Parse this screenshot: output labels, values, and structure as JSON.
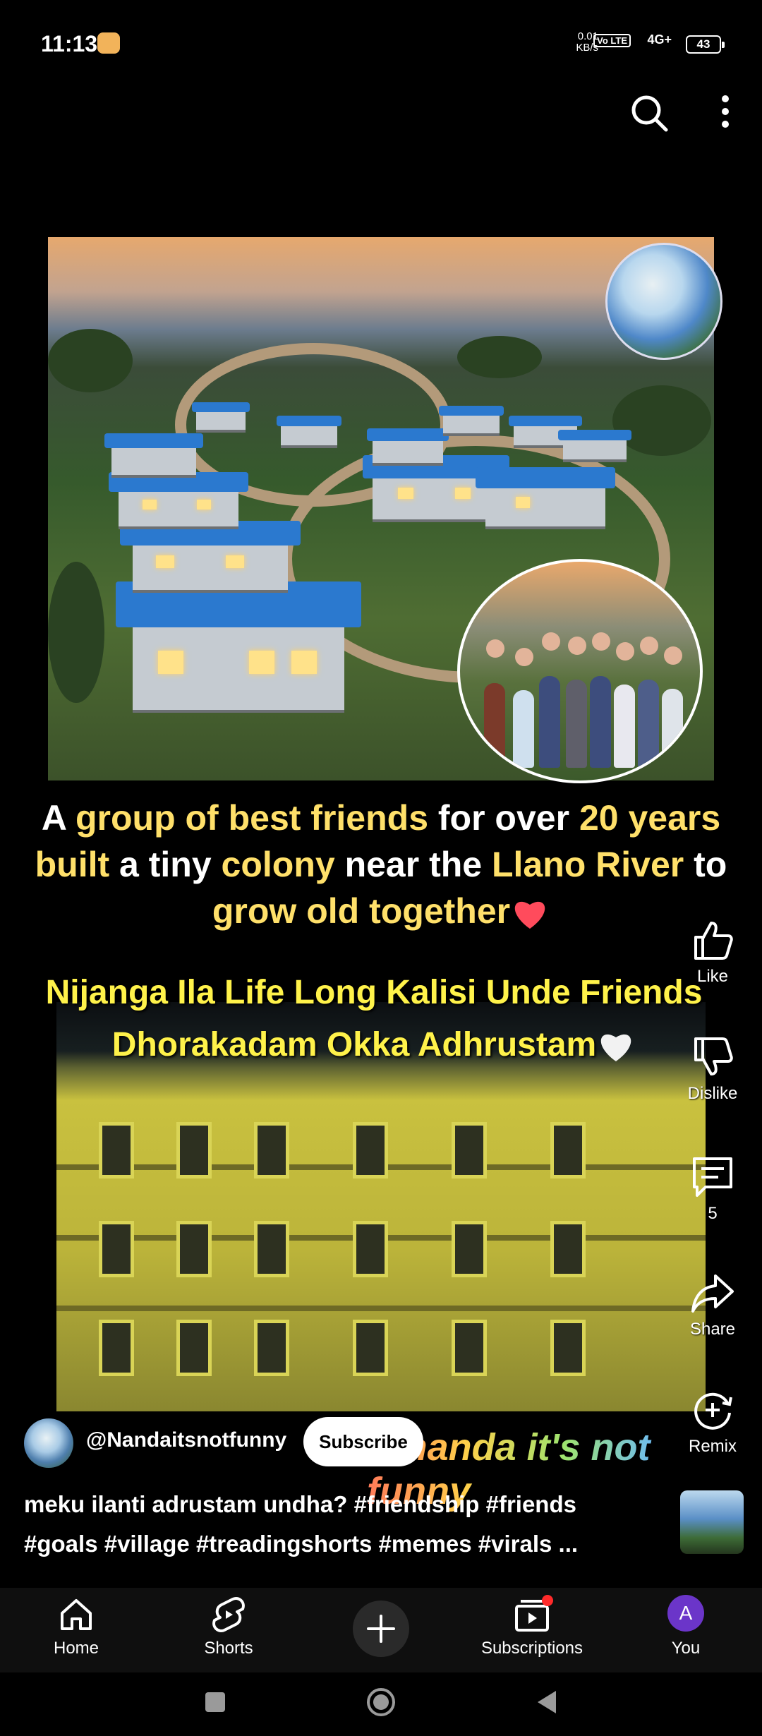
{
  "status_bar": {
    "time": "11:13",
    "net_speed_value": "0.01",
    "net_speed_unit": "KB/s",
    "volte": "Vo LTE",
    "network": "4G+",
    "battery": "43"
  },
  "caption": {
    "line_parts": [
      {
        "text": "A ",
        "hl": false
      },
      {
        "text": "group of best friends",
        "hl": true
      },
      {
        "text": " for over ",
        "hl": false
      },
      {
        "text": "20 years built",
        "hl": true
      },
      {
        "text": " a tiny ",
        "hl": false
      },
      {
        "text": "colony",
        "hl": true
      },
      {
        "text": " near the ",
        "hl": false
      },
      {
        "text": "Llano River",
        "hl": true
      },
      {
        "text": " to ",
        "hl": false
      },
      {
        "text": "grow old together",
        "hl": true
      }
    ],
    "subtitle_line1": "Nijanga Ila Life Long Kalisi Unde Friends",
    "subtitle_line2": "Dhorakadam Okka Adhrustam"
  },
  "watermark": "@nanda it's not funny",
  "actions": {
    "like_label": "Like",
    "dislike_label": "Dislike",
    "comments_count": "5",
    "share_label": "Share",
    "remix_label": "Remix"
  },
  "channel": {
    "handle": "@Nandaitsnotfunny",
    "subscribe_label": "Subscribe"
  },
  "description": {
    "line1": "meku ilanti adrustam undha? #friendship #friends",
    "line2": "#goals #village #treadingshorts #memes #virals ..."
  },
  "nav": {
    "home": "Home",
    "shorts": "Shorts",
    "subscriptions": "Subscriptions",
    "you": "You",
    "you_initial": "A"
  },
  "colors": {
    "highlight": "#ffe06a",
    "subtitle": "#fff24a",
    "roof_blue": "#2b79cf",
    "avatar_purple": "#6b35c9",
    "badge_red": "#ff2a2a"
  }
}
